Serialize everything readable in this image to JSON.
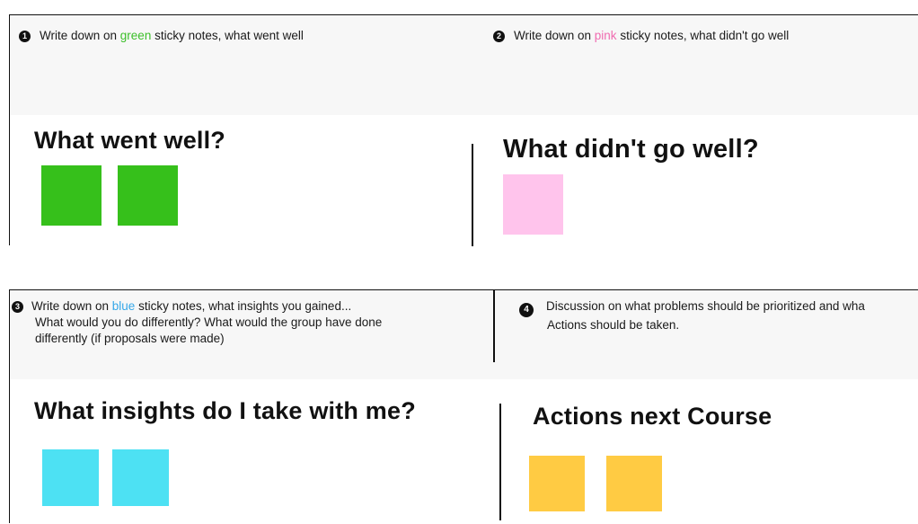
{
  "sections": {
    "went_well": {
      "step": "1",
      "instruction_prefix": "Write down  on ",
      "color_word": "green",
      "instruction_suffix": " sticky notes, what went well",
      "heading": "What went well?",
      "note_color": "#36c01b",
      "note_count": 2
    },
    "didnt_go_well": {
      "step": "2",
      "instruction_prefix": "Write down  on ",
      "color_word": "pink",
      "instruction_suffix": " sticky notes, what didn't go well",
      "heading": "What didn't go well?",
      "note_color": "#ffc4ec",
      "note_count": 1
    },
    "insights": {
      "step": "3",
      "instruction_prefix": "Write down  on ",
      "color_word": "blue",
      "instruction_suffix": " sticky notes, what insights you gained...",
      "instruction_line2": "What would you do differently?  What would the group have done",
      "instruction_line3": "differently (if proposals were made)",
      "heading": "What insights do I take with me?",
      "note_color": "#4de1f3",
      "note_count": 2
    },
    "actions": {
      "step": "4",
      "instruction_line1": "Discussion on what problems should be prioritized and wha",
      "instruction_line2": "Actions should be taken.",
      "heading": "Actions next Course",
      "note_color": "#ffcb43",
      "note_count": 2
    }
  },
  "colors": {
    "green_word": "#3cbf2a",
    "pink_word": "#f06bb0",
    "blue_word": "#35a7e8"
  }
}
